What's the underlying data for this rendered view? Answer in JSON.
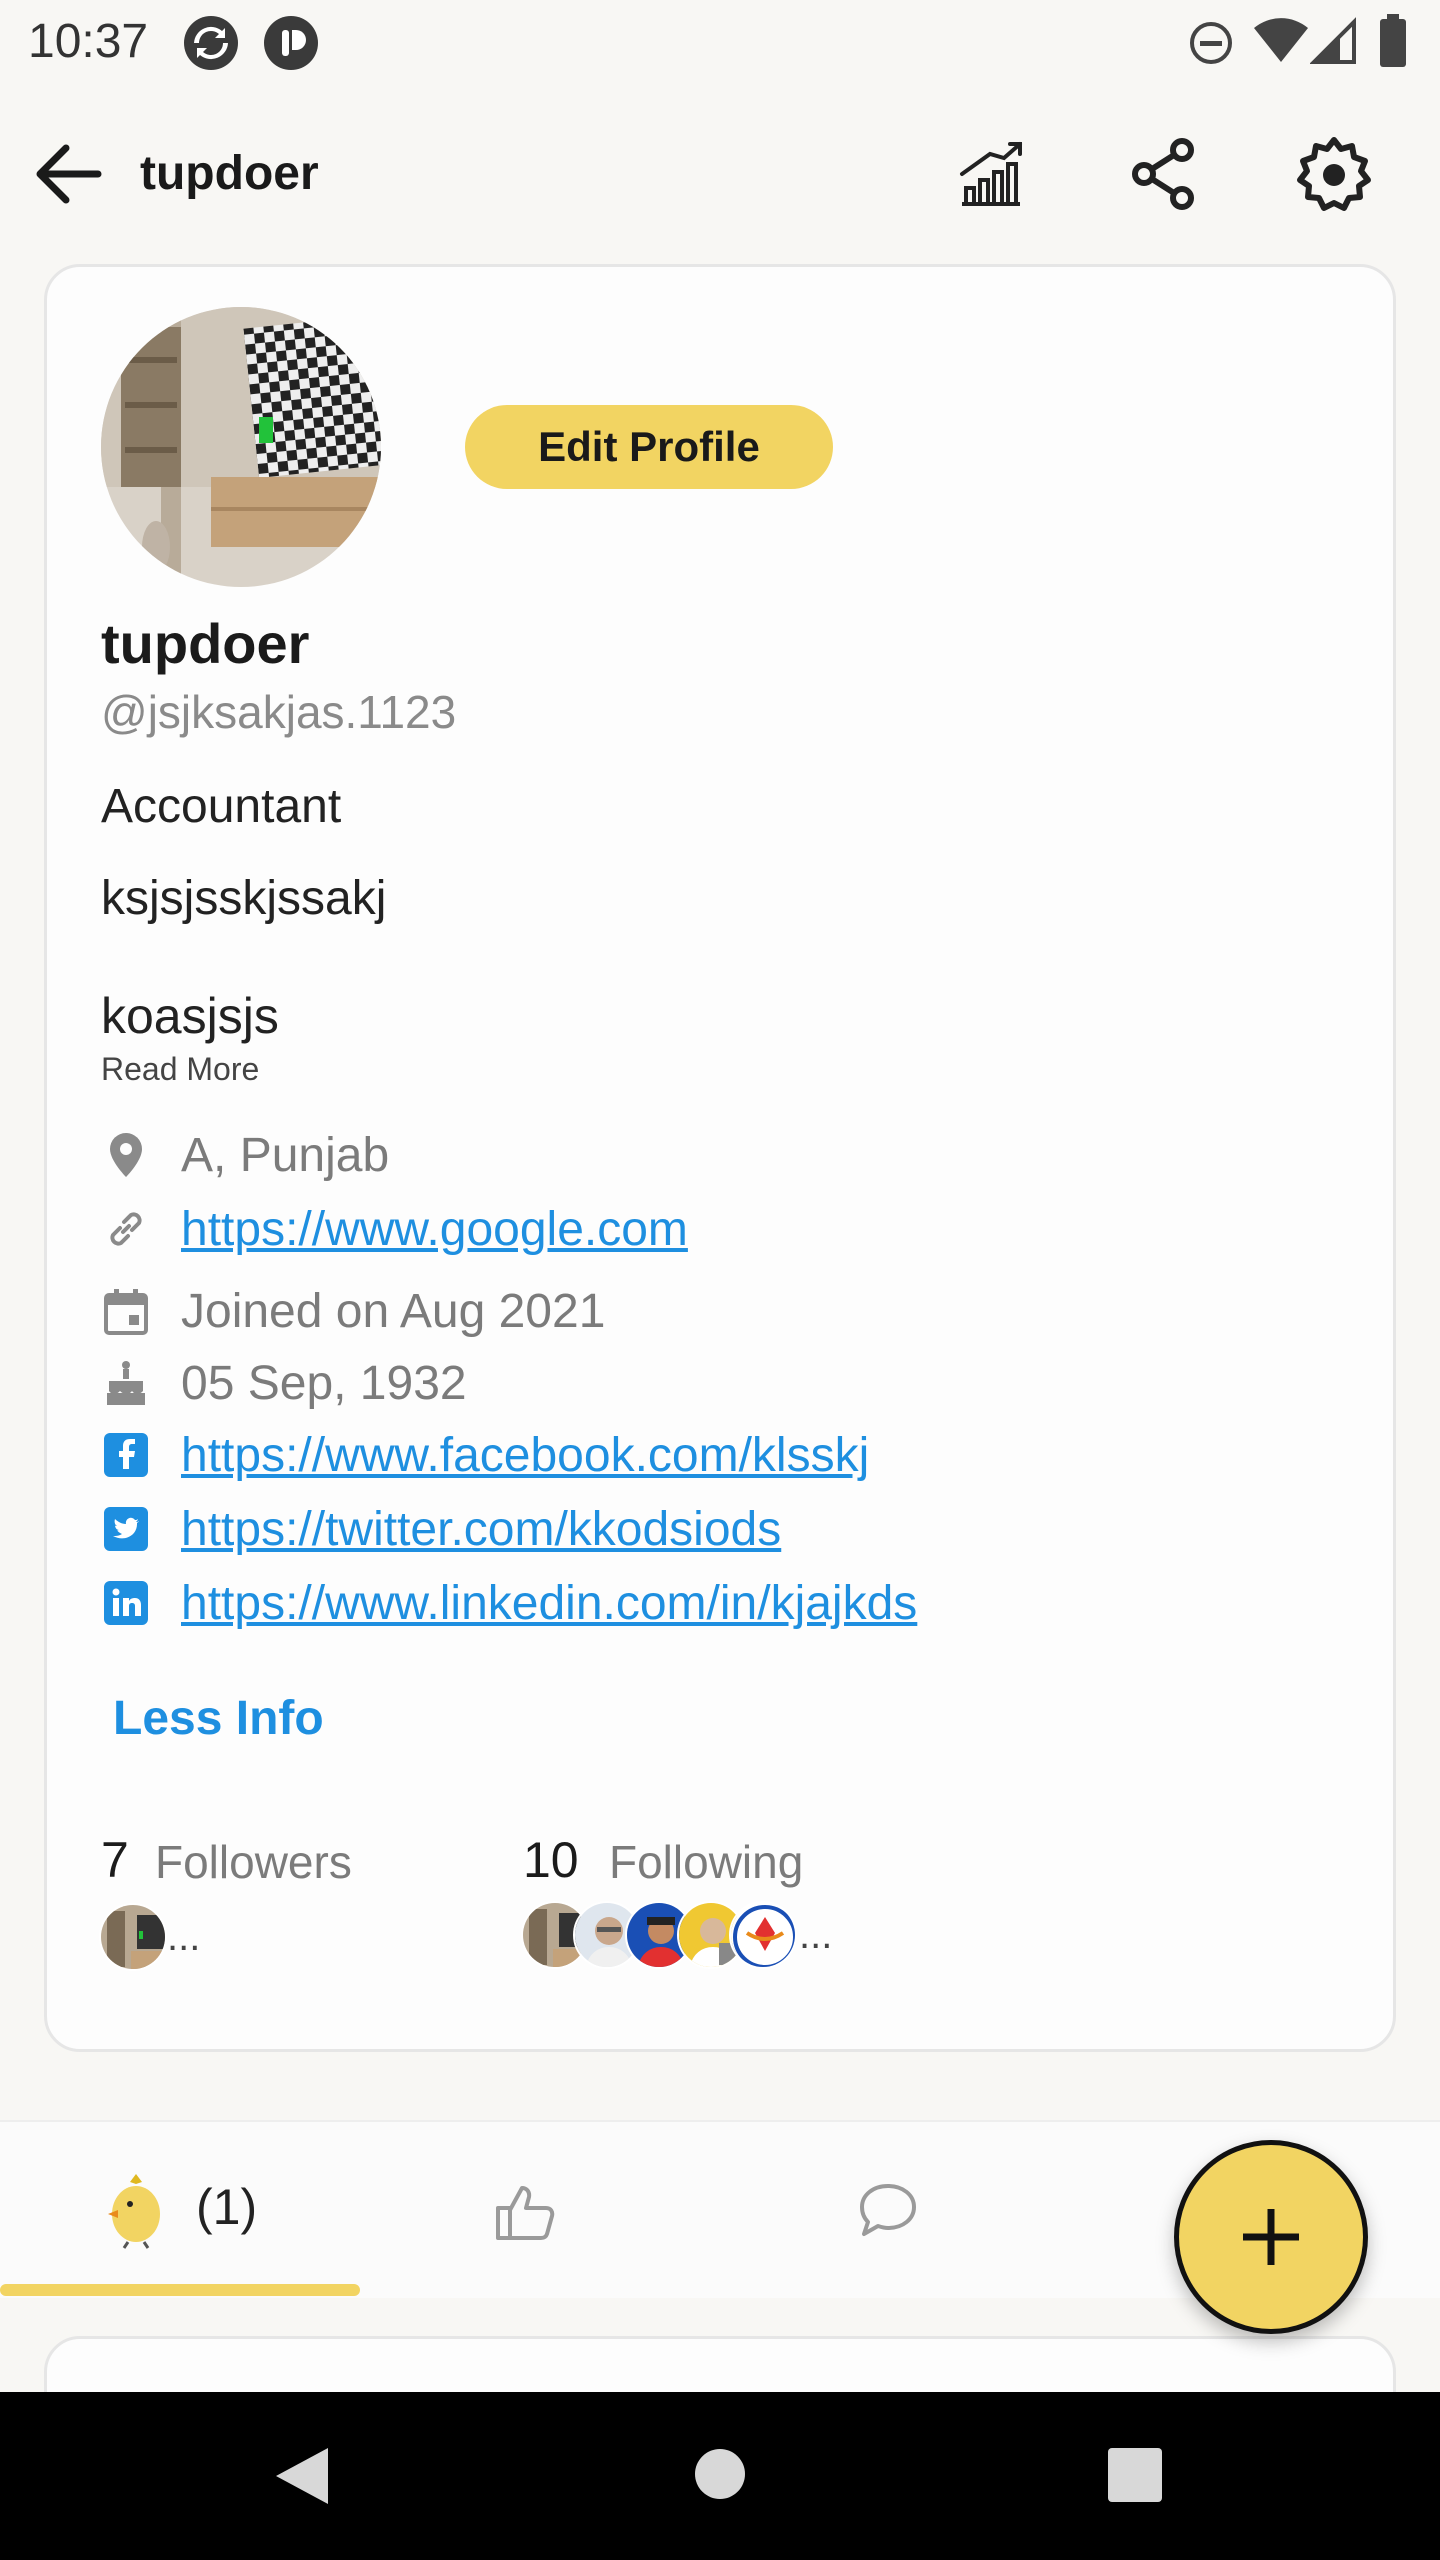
{
  "status_bar": {
    "time": "10:37"
  },
  "app_bar": {
    "title": "tupdoer",
    "icons": [
      "back-arrow-icon",
      "stats-icon",
      "share-icon",
      "settings-icon"
    ]
  },
  "profile": {
    "edit_button_label": "Edit Profile",
    "name": "tupdoer",
    "handle": "@jsjksakjas.1123",
    "job": "Accountant",
    "bio_line_1": "ksjsjsskjssakj",
    "bio_line_2": "koasjsjs",
    "read_more_label": "Read More",
    "info": {
      "location": "A, Punjab",
      "website": "https://www.google.com",
      "joined": "Joined on Aug 2021",
      "birthday": "05 Sep, 1932",
      "facebook": "https://www.facebook.com/klsskj",
      "twitter": "https://twitter.com/kkodsiods",
      "linkedin": "https://www.linkedin.com/in/kjajkds"
    },
    "less_info_label": "Less Info",
    "followers": {
      "count": "7",
      "label": "Followers",
      "more": "..."
    },
    "following": {
      "count": "10",
      "label": "Following",
      "more": "..."
    }
  },
  "tabs": {
    "posts_count": "(1)",
    "icons": [
      "chick-icon",
      "thumbs-up-icon",
      "comment-icon"
    ]
  },
  "colors": {
    "accent_yellow": "#f2d462",
    "link_blue": "#1e8fe0",
    "muted_text": "#7b7b7b"
  }
}
